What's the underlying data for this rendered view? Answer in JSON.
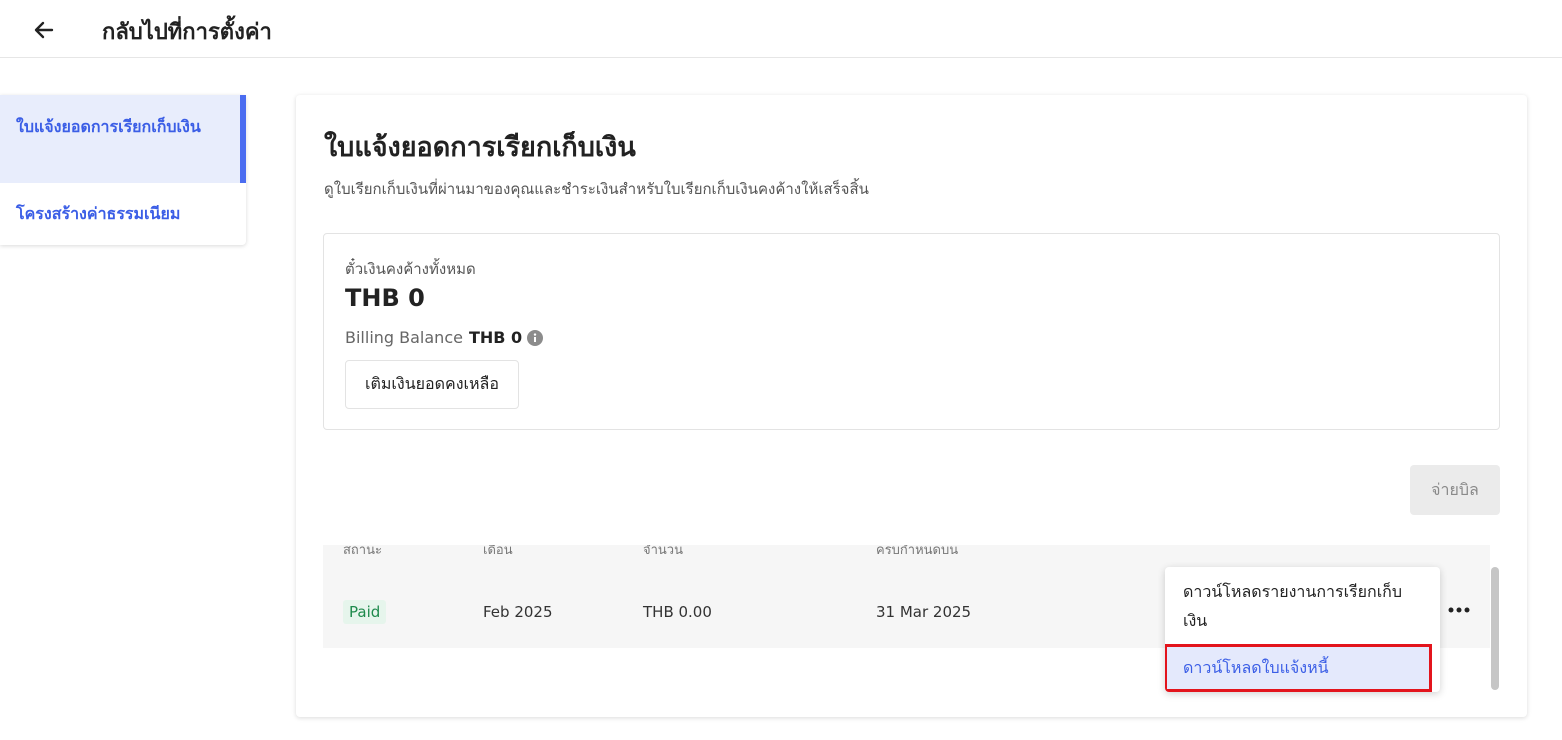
{
  "header": {
    "back_icon": "arrow-left-icon",
    "title": "กลับไปที่การตั้งค่า"
  },
  "sidebar": {
    "items": [
      {
        "label": "ใบแจ้งยอดการเรียกเก็บเงิน",
        "active": true
      },
      {
        "label": "โครงสร้างค่าธรรมเนียม",
        "active": false
      }
    ]
  },
  "main": {
    "title": "ใบแจ้งยอดการเรียกเก็บเงิน",
    "description": "ดูใบเรียกเก็บเงินที่ผ่านมาของคุณและชำระเงินสำหรับใบเรียกเก็บเงินคงค้างให้เสร็จสิ้น",
    "balance": {
      "label": "ตั๋วเงินคงค้างทั้งหมด",
      "amount": "THB 0",
      "billing_label": "Billing Balance",
      "billing_value": "THB 0",
      "topup_label": "เติมเงินยอดคงเหลือ"
    },
    "pay_button": "จ่ายบิล",
    "table": {
      "headers": [
        "สถานะ",
        "เดือน",
        "จำนวน",
        "ครบกำหนดบน"
      ],
      "rows": [
        {
          "status": "Paid",
          "month": "Feb 2025",
          "amount": "THB 0.00",
          "due": "31 Mar 2025"
        }
      ]
    },
    "menu": {
      "items": [
        "ดาวน์โหลดรายงานการเรียกเก็บเงิน",
        "ดาวน์โหลดใบแจ้งหนี้"
      ]
    }
  },
  "colors": {
    "accent": "#3b5ee6",
    "active_bg": "#e8edfc",
    "paid_text": "#1e8a4c",
    "paid_bg": "#e6f5ec",
    "highlight_border": "#e3141c"
  }
}
